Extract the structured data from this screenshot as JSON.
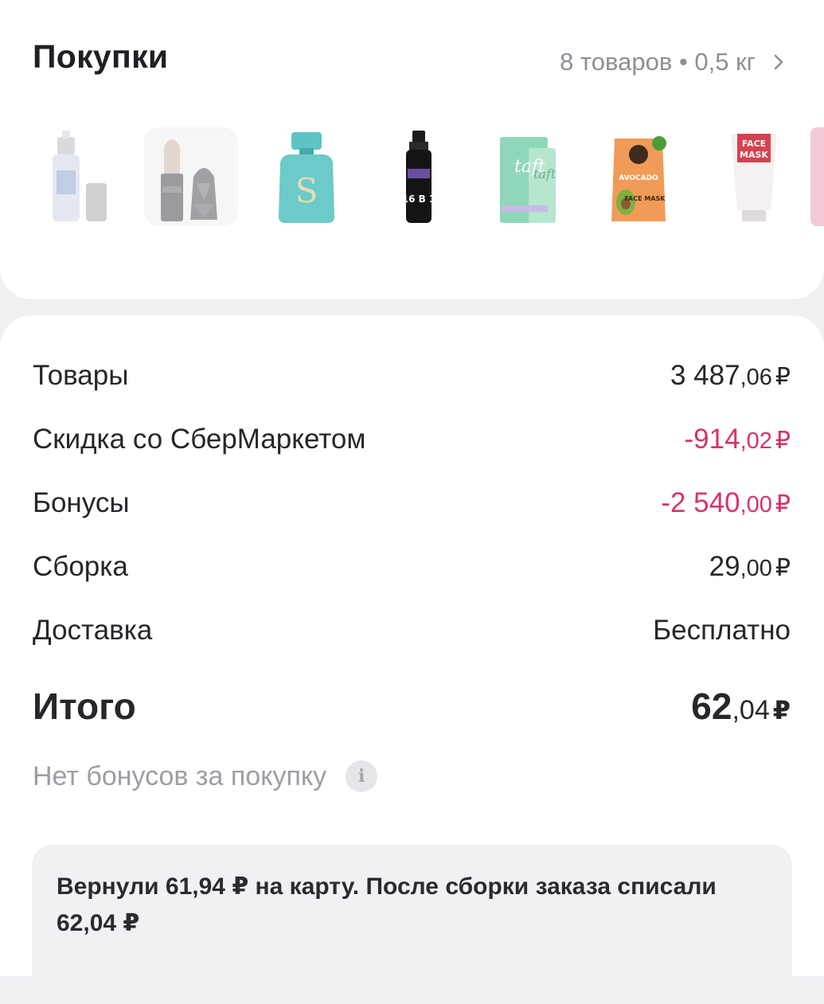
{
  "purchases": {
    "title": "Покупки",
    "summary": "8 товаров • 0,5 кг",
    "items": [
      {
        "name": "spray-bottle",
        "label": ""
      },
      {
        "name": "lipstick",
        "label": "SOLANO"
      },
      {
        "name": "perfume",
        "label": "S"
      },
      {
        "name": "hair-spray",
        "label": "16 В 1"
      },
      {
        "name": "taft-gel",
        "label": "taft"
      },
      {
        "name": "avocado-mask",
        "label": "AVOCADO FACE MASK"
      },
      {
        "name": "face-mask-tube",
        "label": "FACE MASK"
      },
      {
        "name": "pink-item",
        "label": ""
      }
    ]
  },
  "summary": {
    "rows": [
      {
        "label": "Товары",
        "int": "3 487",
        "cents": ",06",
        "cur": "₽",
        "negative": false
      },
      {
        "label": "Скидка со СберМаркетом",
        "int": "-914",
        "cents": ",02",
        "cur": "₽",
        "negative": true
      },
      {
        "label": "Бонусы",
        "int": "-2 540",
        "cents": ",00",
        "cur": "₽",
        "negative": true
      },
      {
        "label": "Сборка",
        "int": "29",
        "cents": ",00",
        "cur": "₽",
        "negative": false
      },
      {
        "label": "Доставка",
        "text": "Бесплатно"
      }
    ],
    "total": {
      "label": "Итого",
      "int": "62",
      "cents": ",04",
      "cur": "₽"
    },
    "no_bonus": "Нет бонусов за покупку",
    "info_glyph": "i"
  },
  "refund": {
    "text": "Вернули 61,94 ₽ на карту. После сборки заказа списали 62,04 ₽"
  },
  "colors": {
    "negative": "#d8326c",
    "muted": "#8d8f97"
  }
}
